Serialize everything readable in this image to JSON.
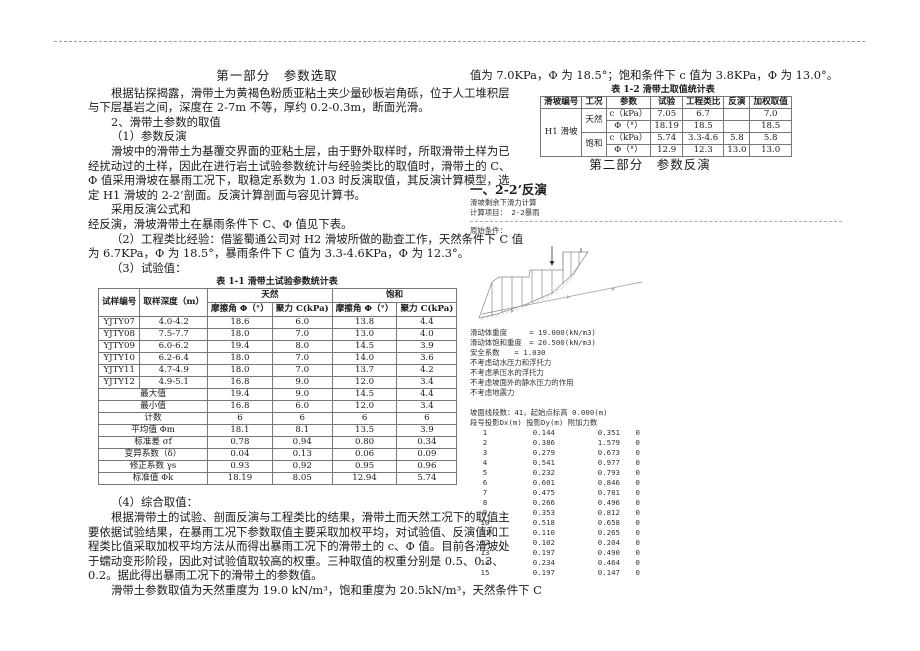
{
  "part1": {
    "title": "第一部分　参数选取",
    "para1_l1": "根据钻探揭露，滑带土为黄褐色粉质亚粘土夹少量砂板岩角砾，位于人工堆积层",
    "para1_l2": "与下层基岩之间，深度在 2-7m 不等，厚约 0.2-0.3m，断面光滑。",
    "sec2": "2、滑带土参数的取值",
    "sub1": "（1）参数反演",
    "para2_l1": "滑坡中的滑带土为基覆交界面的亚粘土层，由于野外取样时，所取滑带土样为已",
    "para2_l2": "经扰动过的土样，因此在进行岩土试验参数统计与经验类比的取值时，滑带土的 C、",
    "para2_l3": "Φ 值采用滑坡在暴雨工况下，取稳定系数为 1.03 时反演取值，其反演计算模型，选",
    "para2_l4": "定 H1 滑坡的 2-2’剖面。反演计算剖面与容见计算书。",
    "para3": "采用反演公式和",
    "para4": "经反演，滑坡滑带土在暴雨条件下 C、Φ 值见下表。",
    "sub2_l1": "（2）工程类比经验：借鉴蜀通公司对 H2 滑坡所做的勘查工作，天然条件下 C 值",
    "sub2_l2": "为 6.7KPa，Φ 为 18.5°，暴雨条件下 C 值为 3.3-4.6KPa，Φ 为 12.3°。",
    "sub3": "（3）试验值：",
    "sub4": "（4）综合取值：",
    "para5_l1": "根据滑带土的试验、剖面反演与工程类比的结果，滑带土而天然工况下的取值主",
    "para5_l2": "要依据试验结果，在暴雨工况下参数取值主要采取加权平均，对试验值、反演值和工",
    "para5_l3": "程类比值采取加权平均方法从而得出暴雨工况下的滑带土的 c、Φ 值。目前各滑坡处",
    "para5_l4": "于蠕动变形阶段，因此对试验值取较高的权重。三种取值的权重分别是 0.5、0.3、",
    "para5_l5": "0.2。据此得出暴雨工况下的滑带土的参数值。",
    "para6_l1": "滑带土参数取值为天然重度为 19.0 kN/m³，饱和重度为 20.5kN/m³，天然条件下 C",
    "para6_l2": "值为 7.0KPa，Φ 为 18.5°；饱和条件下 c 值为 3.8KPa，Φ 为 13.0°。"
  },
  "table11": {
    "title": "表 1-1  滑带土试验参数统计表",
    "headers": {
      "sample_id": "试样编号",
      "depth": "取样深度（m）",
      "natural": "天然",
      "saturated": "饱和",
      "friction_nat": "摩擦角 Φ（°）",
      "cohesion_nat": "聚力 C(kPa)",
      "friction_sat": "摩擦角 Φ（°）",
      "cohesion_sat": "聚力 C(kPa)"
    },
    "rows": [
      {
        "id": "YJTY07",
        "depth": "4.0-4.2",
        "phi_n": "18.6",
        "c_n": "6.0",
        "phi_s": "13.8",
        "c_s": "4.4"
      },
      {
        "id": "YJTY08",
        "depth": "7.5-7.7",
        "phi_n": "18.0",
        "c_n": "7.0",
        "phi_s": "13.0",
        "c_s": "4.0"
      },
      {
        "id": "YJTY09",
        "depth": "6.0-6.2",
        "phi_n": "19.4",
        "c_n": "8.0",
        "phi_s": "14.5",
        "c_s": "3.9"
      },
      {
        "id": "YJTY10",
        "depth": "6.2-6.4",
        "phi_n": "18.0",
        "c_n": "7.0",
        "phi_s": "14.0",
        "c_s": "3.6"
      },
      {
        "id": "YJTY11",
        "depth": "4.7-4.9",
        "phi_n": "18.0",
        "c_n": "7.0",
        "phi_s": "13.7",
        "c_s": "4.2"
      },
      {
        "id": "YJTY12",
        "depth": "4.9-5.1",
        "phi_n": "16.8",
        "c_n": "9.0",
        "phi_s": "12.0",
        "c_s": "3.4"
      }
    ],
    "stats": [
      {
        "label": "最大值",
        "phi_n": "19.4",
        "c_n": "9.0",
        "phi_s": "14.5",
        "c_s": "4.4"
      },
      {
        "label": "最小值",
        "phi_n": "16.8",
        "c_n": "6.0",
        "phi_s": "12.0",
        "c_s": "3.4"
      },
      {
        "label": "计数",
        "phi_n": "6",
        "c_n": "6",
        "phi_s": "6",
        "c_s": "6"
      },
      {
        "label": "平均值 Φm",
        "phi_n": "18.1",
        "c_n": "8.1",
        "phi_s": "13.5",
        "c_s": "3.9"
      },
      {
        "label": "标准差 σf",
        "phi_n": "0.78",
        "c_n": "0.94",
        "phi_s": "0.80",
        "c_s": "0.34"
      },
      {
        "label": "变异系数（δ）",
        "phi_n": "0.04",
        "c_n": "0.13",
        "phi_s": "0.06",
        "c_s": "0.09"
      },
      {
        "label": "修正系数 γs",
        "phi_n": "0.93",
        "c_n": "0.92",
        "phi_s": "0.95",
        "c_s": "0.96"
      },
      {
        "label": "标准值 Φk",
        "phi_n": "18.19",
        "c_n": "8.05",
        "phi_s": "12.94",
        "c_s": "5.74"
      }
    ]
  },
  "table12": {
    "title": "表 1-2  滑带土取值统计表",
    "headers": [
      "滑坡编号",
      "工况",
      "参数",
      "试验",
      "工程类比",
      "反演",
      "加权取值"
    ],
    "slide_id": "H1 滑坡",
    "cond_natural": "天然",
    "cond_saturated": "饱和",
    "rows": [
      {
        "param": "c（kPa）",
        "test": "7.05",
        "analog": "6.7",
        "back": "",
        "weighted": "7.0"
      },
      {
        "param": "Φ（°）",
        "test": "18.19",
        "analog": "18.5",
        "back": "",
        "weighted": "18.5"
      },
      {
        "param": "c（kPa）",
        "test": "5.74",
        "analog": "3.3-4.6",
        "back": "5.8",
        "weighted": "5.8"
      },
      {
        "param": "Φ（°）",
        "test": "12.9",
        "analog": "12.3",
        "back": "13.0",
        "weighted": "13.0"
      }
    ]
  },
  "part2": {
    "title": "第二部分　参数反演",
    "section": "一、2-2’反演",
    "calc_title": "滑坡剩余下滑力计算",
    "calc_project": "计算项目： 2-2暴雨",
    "original_conditions": "原始条件：",
    "params": [
      "滑动体重度　　　= 19.000(kN/m3)",
      "滑动体饱和重度　= 20.500(kN/m3)",
      "安全系数　　= 1.030",
      "不考虑动水压力和浮托力",
      "不考虑承压水的浮托力",
      "不考虑坡面外的静水压力的作用",
      "不考虑地震力"
    ],
    "segments_summary": "坡面线段数：41，起始点标高 0.000(m)",
    "segments_header": "段号投影Dx(m) 投影Dy(m) 附加力数",
    "segments": [
      {
        "no": "1",
        "dx": "0.144",
        "dy": "0.351",
        "f": "0"
      },
      {
        "no": "2",
        "dx": "0.386",
        "dy": "1.579",
        "f": "0"
      },
      {
        "no": "3",
        "dx": "0.279",
        "dy": "0.673",
        "f": "0"
      },
      {
        "no": "4",
        "dx": "0.541",
        "dy": "0.977",
        "f": "0"
      },
      {
        "no": "5",
        "dx": "0.232",
        "dy": "0.793",
        "f": "0"
      },
      {
        "no": "6",
        "dx": "0.601",
        "dy": "0.846",
        "f": "0"
      },
      {
        "no": "7",
        "dx": "0.475",
        "dy": "0.781",
        "f": "0"
      },
      {
        "no": "8",
        "dx": "0.266",
        "dy": "0.496",
        "f": "0"
      },
      {
        "no": "9",
        "dx": "0.353",
        "dy": "0.812",
        "f": "0"
      },
      {
        "no": "10",
        "dx": "0.518",
        "dy": "0.658",
        "f": "0"
      },
      {
        "no": "11",
        "dx": "0.110",
        "dy": "0.265",
        "f": "0"
      },
      {
        "no": "12",
        "dx": "0.102",
        "dy": "0.204",
        "f": "0"
      },
      {
        "no": "13",
        "dx": "0.197",
        "dy": "0.490",
        "f": "0"
      },
      {
        "no": "14",
        "dx": "0.234",
        "dy": "0.464",
        "f": "0"
      },
      {
        "no": "15",
        "dx": "0.197",
        "dy": "0.147",
        "f": "0"
      }
    ]
  }
}
